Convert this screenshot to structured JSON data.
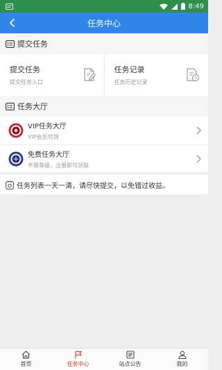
{
  "status_bar": {
    "time": "8:49"
  },
  "app_bar": {
    "title": "任务中心",
    "back_icon": "back-arrow-icon"
  },
  "submit_section": {
    "title": "提交任务",
    "cards": [
      {
        "title": "提交任务",
        "subtitle": "提交任务入口",
        "icon": "edit-document-icon"
      },
      {
        "title": "任务记录",
        "subtitle": "任务历史记录",
        "icon": "history-document-icon"
      }
    ]
  },
  "hall_section": {
    "title": "任务大厅",
    "items": [
      {
        "title": "VIP任务大厅",
        "subtitle": "VIP会员可领",
        "icon": "vip-badge-icon"
      },
      {
        "title": "免费任务大厅",
        "subtitle": "不限等级，注册即可领取",
        "icon": "free-badge-icon"
      }
    ]
  },
  "notice": {
    "text": "任务列表一天一清，请尽快提交，以免错过收益。"
  },
  "tab_bar": {
    "items": [
      {
        "label": "首页",
        "icon": "home-icon"
      },
      {
        "label": "任务中心",
        "icon": "flag-icon"
      },
      {
        "label": "站点公告",
        "icon": "announcement-icon"
      },
      {
        "label": "我的",
        "icon": "profile-icon"
      }
    ],
    "active_index": 1
  },
  "colors": {
    "status_bar": "#2e8f4a",
    "app_bar": "#2f86e8",
    "active_tab": "#d8382c"
  }
}
